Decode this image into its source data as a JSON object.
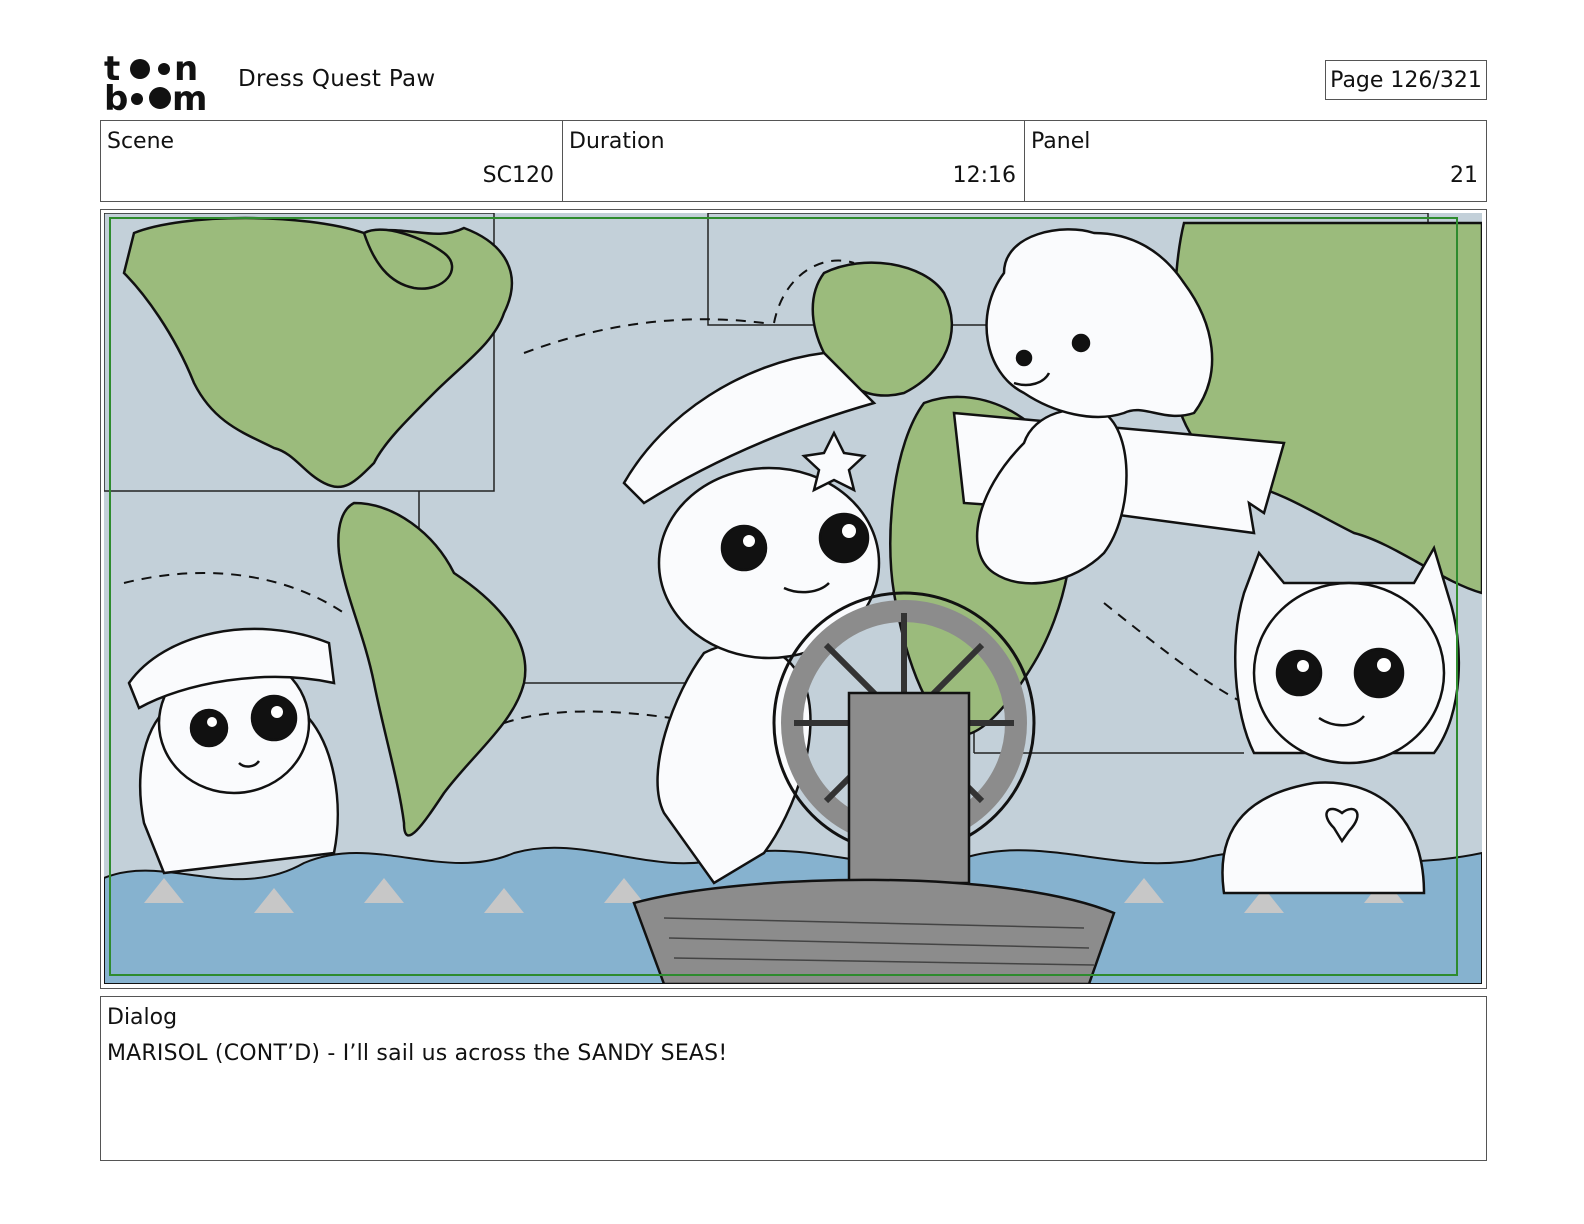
{
  "header": {
    "logo_top": "toon",
    "logo_bottom": "boom",
    "project_title": "Dress Quest Paw",
    "page_indicator": "Page 126/321"
  },
  "info": {
    "scene_label": "Scene",
    "scene_value": "SC120",
    "duration_label": "Duration",
    "duration_value": "12:16",
    "panel_label": "Panel",
    "panel_value": "21"
  },
  "dialog": {
    "label": "Dialog",
    "text": "MARISOL (CONT’D) - I’ll sail us across the SANDY SEAS!"
  },
  "colors": {
    "ocean": "#c3d0d9",
    "land": "#9bbb7c",
    "water": "#86b2cf",
    "safe_frame": "#2e8b2e",
    "boat": "#8c8c8c"
  }
}
